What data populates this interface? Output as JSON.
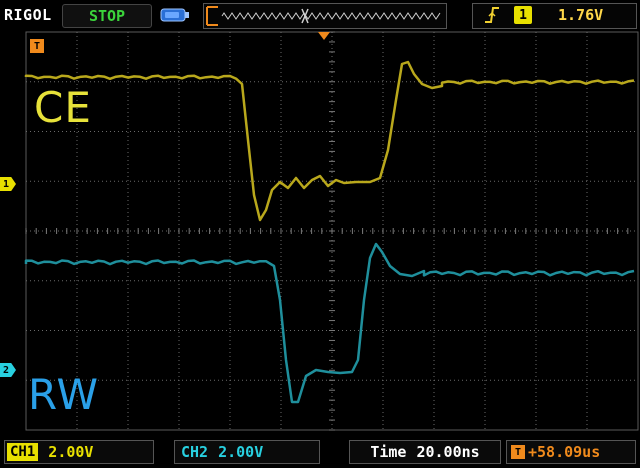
{
  "top": {
    "brand": "RIGOL",
    "run_state": "STOP",
    "trigger_source": "1",
    "trigger_level": "1.76V"
  },
  "markers": {
    "trigger": "T",
    "ch1": "1",
    "ch2": "2"
  },
  "traces": {
    "ch1_label": "CE",
    "ch2_label": "RW"
  },
  "bottom": {
    "ch1_tag": "CH1",
    "ch1_scale": "2.00V",
    "ch2_tag": "CH2",
    "ch2_scale": "2.00V",
    "time_label": "Time",
    "time_scale": "20.00ns",
    "trigger_offset": "58.09us",
    "trigger_offset_prefix": "+"
  },
  "colors": {
    "ch1": "#b9a81c",
    "ch2": "#1f8f9c",
    "trigger": "#f08a1c",
    "run_state": "#3bd43b"
  },
  "icons": {
    "usb": "usb-stick-icon",
    "edge": "rising-edge-icon",
    "trigger_marker": "trigger-position-icon"
  }
}
